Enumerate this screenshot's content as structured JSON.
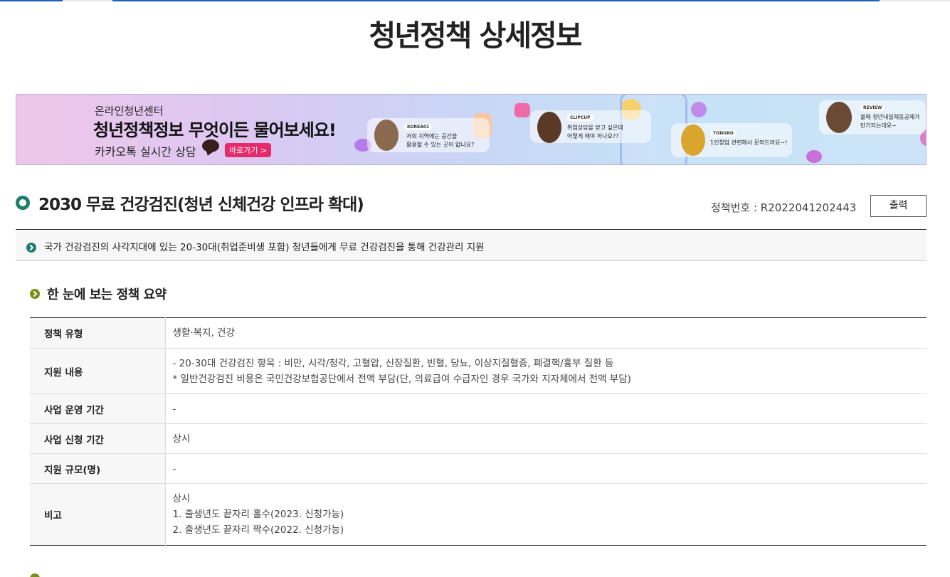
{
  "page": {
    "title": "청년정책 상세정보"
  },
  "banner": {
    "subtitle": "온라인청년센터",
    "headline": "청년정책정보 무엇이든 물어보세요!",
    "kakao_text": "카카오톡 실시간 상담",
    "go_label": "바로가기 >",
    "bubbles": [
      {
        "tag": "KOREA01",
        "line1": "저희 지역에는 공간을",
        "line2": "활용할 수 있는 곳이 없나요?"
      },
      {
        "tag": "CLIPCUP",
        "line1": "취업상담을 받고 싶은데",
        "line2": "어떻게 해야 하나요??"
      },
      {
        "tag": "TONGRO",
        "line1": "1인창업 관련해서 문의드려요~!",
        "line2": ""
      },
      {
        "tag": "REVIEW",
        "line1": "올해 청년내일채움공제가",
        "line2": "만기되는데요~"
      }
    ]
  },
  "policy": {
    "title": "2030 무료 건강검진(청년 신체건강 인프라 확대)",
    "number_label": "정책번호 : R2022041202443",
    "print_label": "출력",
    "description": "국가 건강검진의 사각지대에 있는 20-30대(취업준비생 포함) 청년들에게 무료 건강검진을 통해 건강관리 지원"
  },
  "summary": {
    "section_title": "한 눈에 보는 정책 요약",
    "rows": [
      {
        "label": "정책 유형",
        "lines": [
          "생활·복지, 건강"
        ]
      },
      {
        "label": "지원 내용",
        "lines": [
          "- 20-30대 건강검진 항목 : 비만, 시각/청각, 고혈압, 신장질환, 빈혈, 당뇨, 이상지질혈증, 폐결핵/흉부 질환 등",
          "* 일반건강검진 비용은 국민건강보험공단에서 전액 부담(단, 의료급여 수급자인 경우 국가와 지자체에서 전액 부담)"
        ]
      },
      {
        "label": "사업 운영 기간",
        "lines": [
          "-"
        ]
      },
      {
        "label": "사업 신청 기간",
        "lines": [
          "상시"
        ]
      },
      {
        "label": "지원 규모(명)",
        "lines": [
          "-"
        ]
      },
      {
        "label": "비고",
        "lines": [
          "상시",
          "1. 출생년도 끝자리 홀수(2023. 신청가능)",
          "2. 출생년도 끝자리 짝수(2022. 신청가능)"
        ]
      }
    ]
  },
  "colors": {
    "accent_green": "#1f7d6a",
    "section_olive": "#7a8f1c",
    "banner_pink": "#e62a6a",
    "top_bar": "#1d5fb6"
  }
}
